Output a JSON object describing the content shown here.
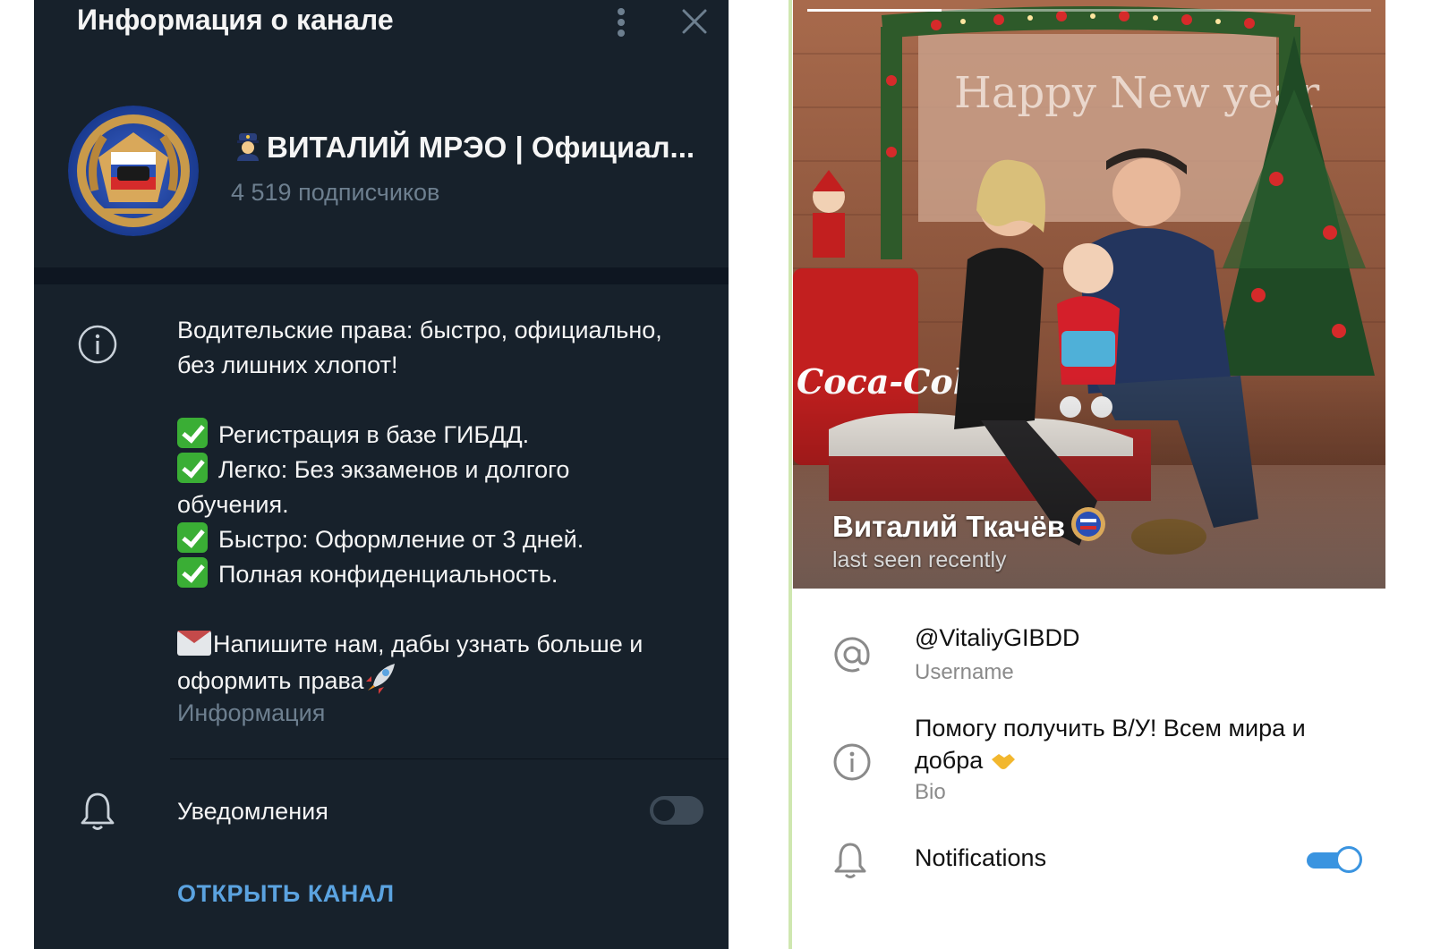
{
  "left": {
    "title": "Информация о канале",
    "channel_name": "ВИТАЛИЙ МРЭО | Официал...",
    "subscribers": "4 519 подписчиков",
    "description": {
      "line1": "Водительские права: быстро, официально,",
      "line2": "без лишних хлопот!",
      "item1": "Регистрация в базе ГИБДД.",
      "item2a": "Легко: Без экзаменов и долгого",
      "item2b": "обучения.",
      "item3": "Быстро: Оформление от 3 дней.",
      "item4": "Полная конфиденциальность.",
      "cta1": "Напишите нам, дабы узнать больше и",
      "cta2": "оформить права"
    },
    "description_label": "Информация",
    "notifications_label": "Уведомления",
    "notifications_on": false,
    "open_channel": "ОТКРЫТЬ КАНАЛ",
    "colors": {
      "background": "#17212b",
      "accent": "#5ba3e0",
      "muted": "#6d7f8f"
    }
  },
  "right": {
    "photo_sign": "Happy New year",
    "photo_brand": "Coca-Cola",
    "user_name": "Виталий Ткачёв",
    "status": "last seen recently",
    "username": "@VitaliyGIBDD",
    "username_label": "Username",
    "bio": "Помогу получить В/У! Всем мира и добра",
    "bio_label": "Bio",
    "notifications_label": "Notifications",
    "notifications_on": true,
    "colors": {
      "accent": "#3a94e0"
    }
  }
}
